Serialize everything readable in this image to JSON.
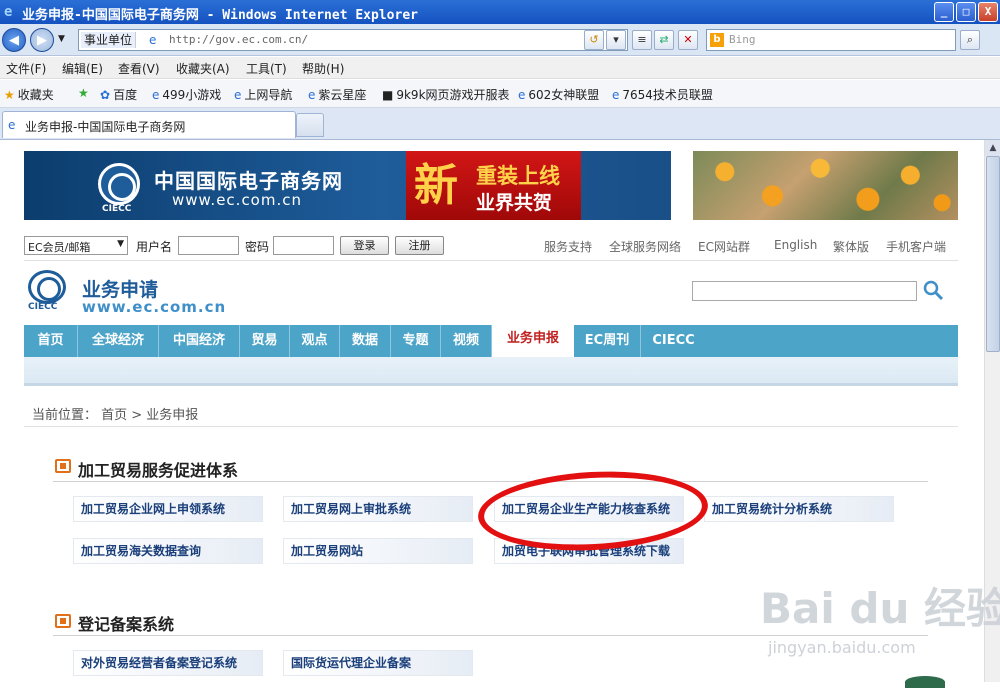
{
  "window": {
    "title": "业务申报-中国国际电子商务网 - Windows Internet Explorer",
    "min_label": "_",
    "max_label": "□",
    "close_label": "X"
  },
  "address": {
    "category": "事业单位",
    "url": "http://gov.ec.com.cn/",
    "search_placeholder": "Bing"
  },
  "menu": [
    "文件(F)",
    "编辑(E)",
    "查看(V)",
    "收藏夹(A)",
    "工具(T)",
    "帮助(H)"
  ],
  "favorites": {
    "label": "收藏夹",
    "items": [
      "百度",
      "499小游戏",
      "上网导航",
      "紫云星座",
      "9k9k网页游戏开服表",
      "602女神联盟",
      "7654技术员联盟"
    ]
  },
  "tab": {
    "title": "业务申报-中国国际电子商务网"
  },
  "banner": {
    "name": "中国国际电子商务网",
    "domain": "www.ec.com.cn",
    "ciecc": "CIECC",
    "promo_big": "新",
    "promo_line1": "重装上线",
    "promo_line2": "业界共贺"
  },
  "login": {
    "select": "EC会员/邮箱",
    "user_label": "用户名",
    "pass_label": "密码",
    "login_btn": "登录",
    "register_btn": "注册",
    "links": [
      "服务支持",
      "全球服务网络",
      "EC网站群",
      "English",
      "繁体版",
      "手机客户端"
    ]
  },
  "header": {
    "title": "业务申请",
    "domain": "www.ec.com.cn",
    "ciecc": "CIECC"
  },
  "nav": [
    "首页",
    "全球经济",
    "中国经济",
    "贸易",
    "观点",
    "数据",
    "专题",
    "视频",
    "业务申报",
    "EC周刊",
    "CIECC"
  ],
  "breadcrumb": {
    "text": "当前位置：  首页 > 业务申报"
  },
  "section1": {
    "title": "加工贸易服务促进体系",
    "tiles": [
      "加工贸易企业网上申领系统",
      "加工贸易网上审批系统",
      "加工贸易企业生产能力核查系统",
      "加工贸易统计分析系统",
      "加工贸易海关数据查询",
      "加工贸易网站",
      "加贸电子联网审批管理系统下载"
    ]
  },
  "section2": {
    "title": "登记备案系统",
    "tiles": [
      "对外贸易经营者备案登记系统",
      "国际货运代理企业备案"
    ]
  },
  "watermark": {
    "brand": "Bai du 经验",
    "sub": "jingyan.baidu.com"
  },
  "colors": {
    "nav": "#4ca4c9",
    "highlight": "#e21010",
    "title_bar": "#1553c0"
  }
}
